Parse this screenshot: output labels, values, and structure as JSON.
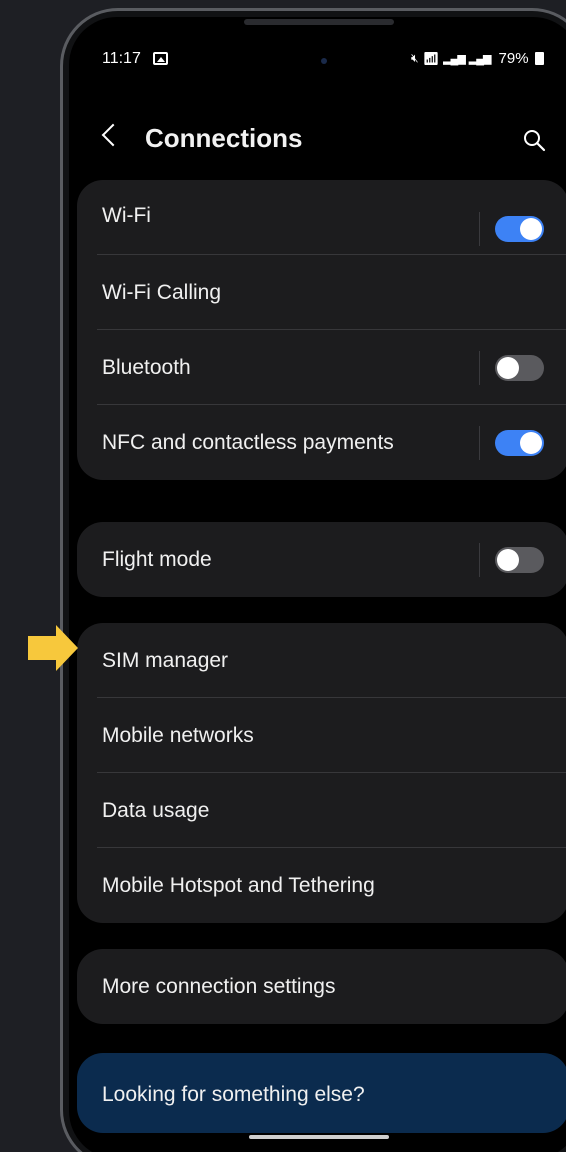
{
  "status_bar": {
    "time": "11:17",
    "battery": "79%",
    "icons": [
      "image-icon",
      "mute-icon",
      "wifi-icon",
      "signal-icon",
      "signal-icon",
      "battery-icon"
    ]
  },
  "header": {
    "title": "Connections"
  },
  "groups": [
    {
      "items": [
        {
          "label": "Wi-Fi",
          "toggle": true
        },
        {
          "label": "Wi-Fi Calling"
        },
        {
          "label": "Bluetooth",
          "toggle": false
        },
        {
          "label": "NFC and contactless payments",
          "toggle": true
        }
      ]
    },
    {
      "items": [
        {
          "label": "Flight mode",
          "toggle": false
        }
      ]
    },
    {
      "items": [
        {
          "label": "SIM manager"
        },
        {
          "label": "Mobile networks"
        },
        {
          "label": "Data usage"
        },
        {
          "label": "Mobile Hotspot and Tethering"
        }
      ]
    },
    {
      "items": [
        {
          "label": "More connection settings"
        }
      ]
    }
  ],
  "help": {
    "title": "Looking for something else?"
  },
  "colors": {
    "toggle_on": "#3d82f5",
    "toggle_off": "#5a5a5e",
    "card_bg": "#1c1c1e",
    "help_bg": "#0b2b4e",
    "pointer_arrow": "#f7c83c"
  }
}
